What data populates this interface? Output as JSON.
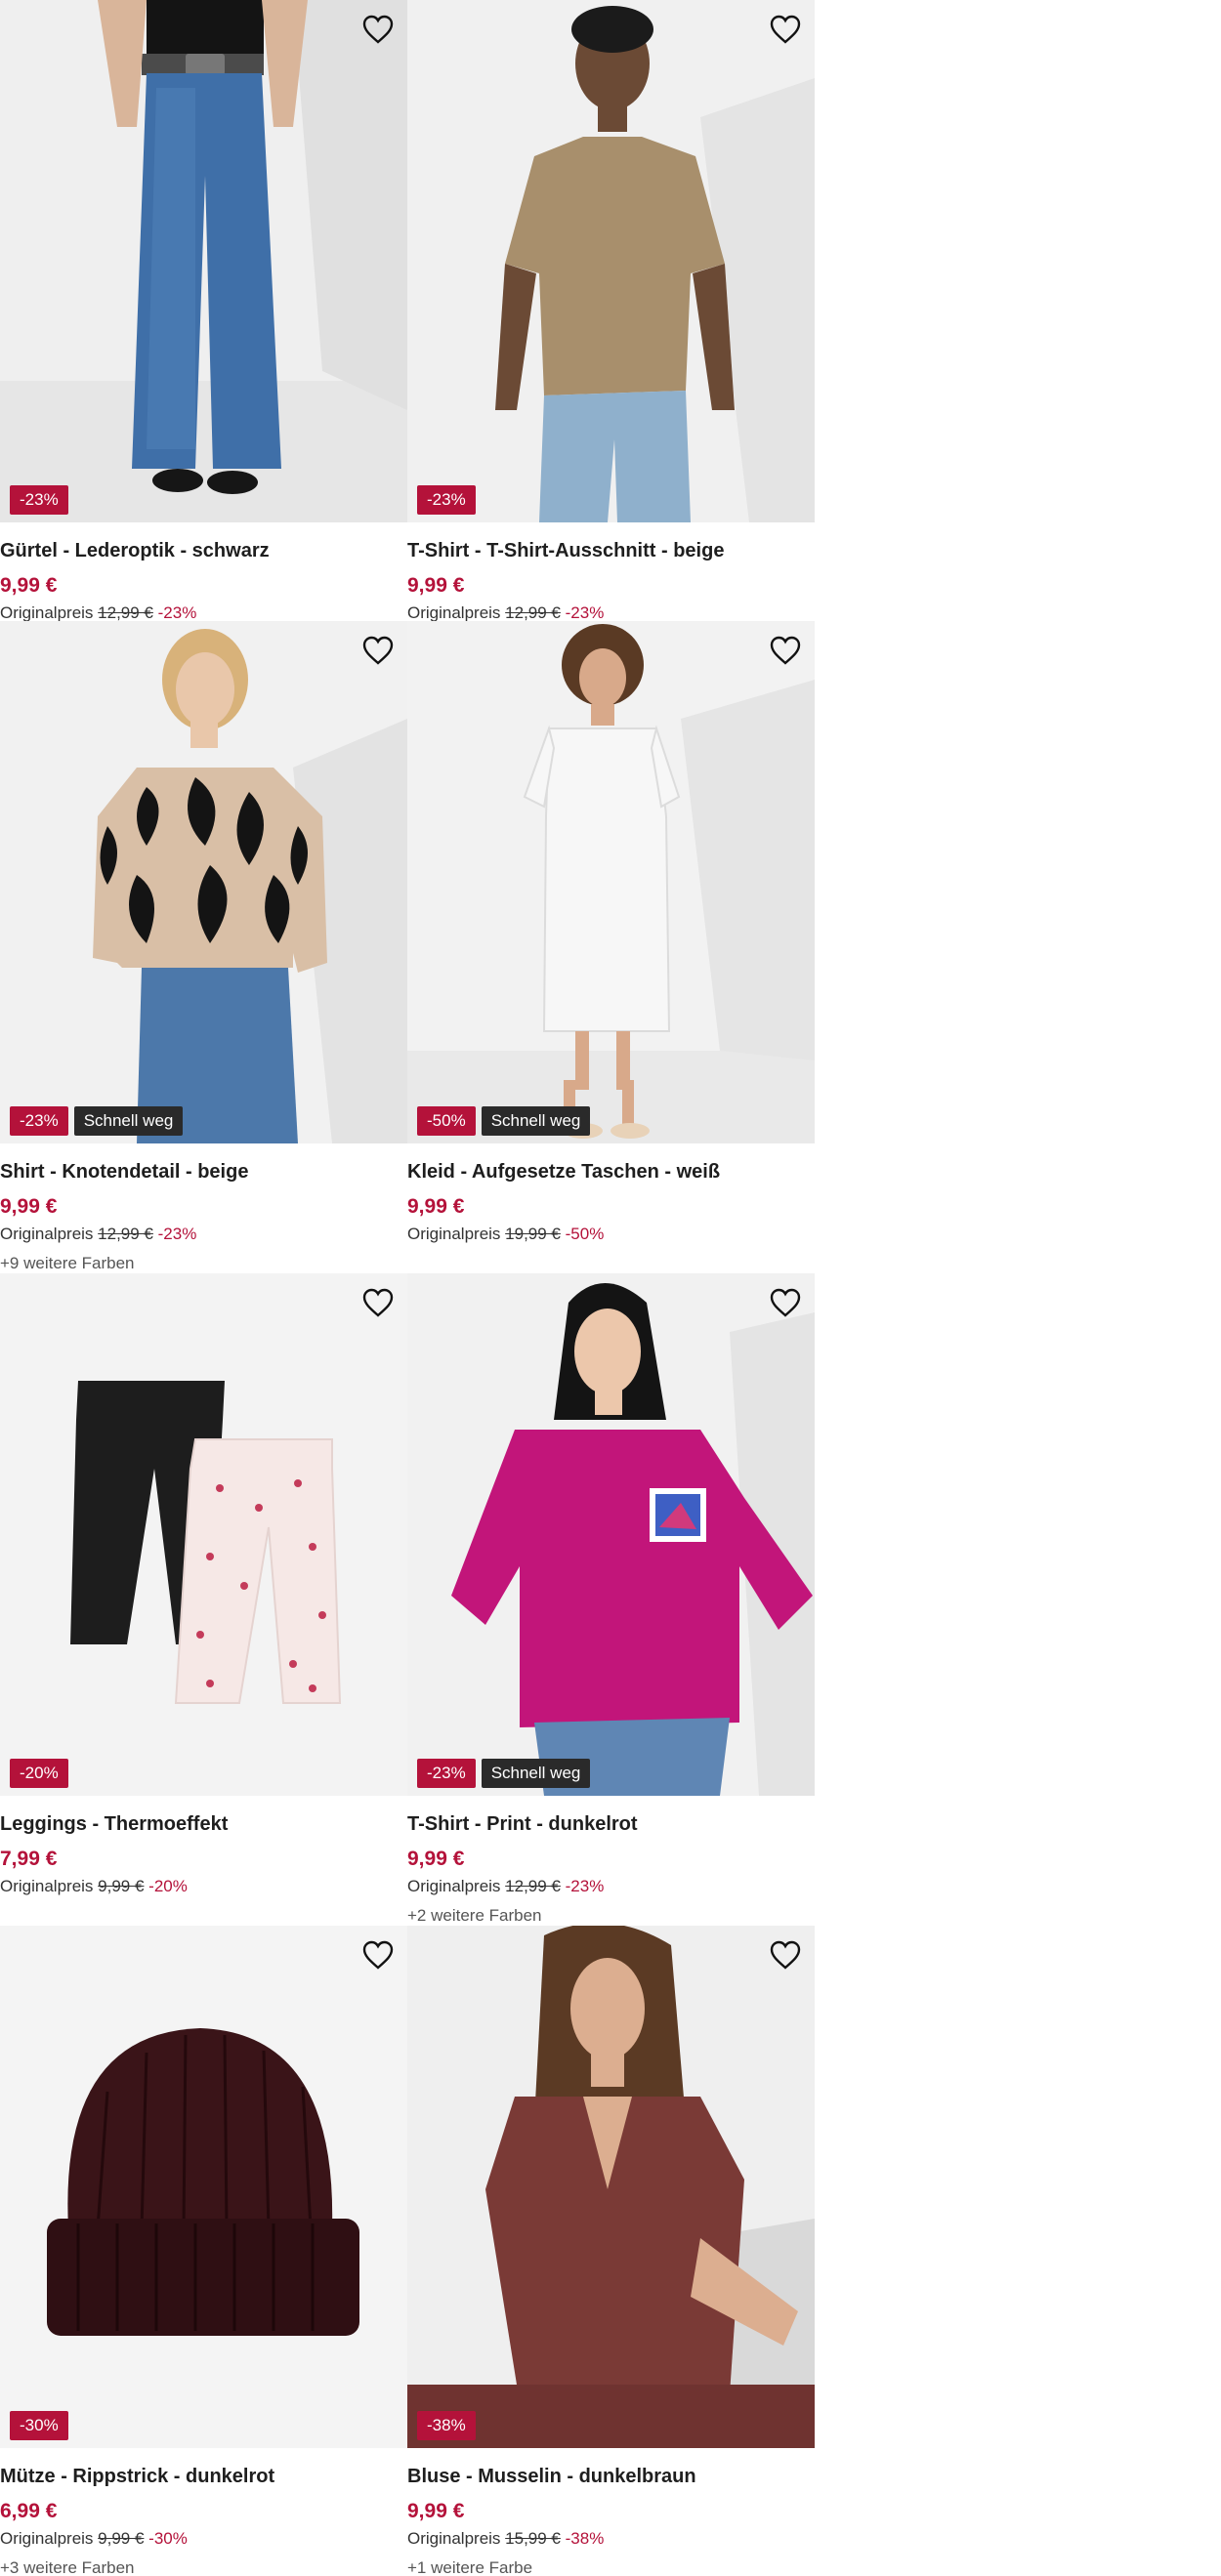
{
  "products": [
    {
      "title": "Gürtel - Lederoptik - schwarz",
      "price": "9,99 €",
      "orig_label": "Originalpreis",
      "orig_price": "12,99 €",
      "discount": "-23%",
      "badge": "-23%",
      "flag": "",
      "more_colors": ""
    },
    {
      "title": "T-Shirt - T-Shirt-Ausschnitt - beige",
      "price": "9,99 €",
      "orig_label": "Originalpreis",
      "orig_price": "12,99 €",
      "discount": "-23%",
      "badge": "-23%",
      "flag": "",
      "more_colors": ""
    },
    {
      "title": "Shirt - Knotendetail - beige",
      "price": "9,99 €",
      "orig_label": "Originalpreis",
      "orig_price": "12,99 €",
      "discount": "-23%",
      "badge": "-23%",
      "flag": "Schnell weg",
      "more_colors": "+9 weitere Farben"
    },
    {
      "title": "Kleid - Aufgesetze Taschen - weiß",
      "price": "9,99 €",
      "orig_label": "Originalpreis",
      "orig_price": "19,99 €",
      "discount": "-50%",
      "badge": "-50%",
      "flag": "Schnell weg",
      "more_colors": ""
    },
    {
      "title": "Leggings - Thermoeffekt",
      "price": "7,99 €",
      "orig_label": "Originalpreis",
      "orig_price": "9,99 €",
      "discount": "-20%",
      "badge": "-20%",
      "flag": "",
      "more_colors": ""
    },
    {
      "title": "T-Shirt - Print - dunkelrot",
      "price": "9,99 €",
      "orig_label": "Originalpreis",
      "orig_price": "12,99 €",
      "discount": "-23%",
      "badge": "-23%",
      "flag": "Schnell weg",
      "more_colors": "+2 weitere Farben"
    },
    {
      "title": "Mütze - Rippstrick - dunkelrot",
      "price": "6,99 €",
      "orig_label": "Originalpreis",
      "orig_price": "9,99 €",
      "discount": "-30%",
      "badge": "-30%",
      "flag": "",
      "more_colors": "+3 weitere Farben"
    },
    {
      "title": "Bluse - Musselin - dunkelbraun",
      "price": "9,99 €",
      "orig_label": "Originalpreis",
      "orig_price": "15,99 €",
      "discount": "-38%",
      "badge": "-38%",
      "flag": "",
      "more_colors": "+1 weitere Farbe"
    }
  ],
  "colors": {
    "accent": "#b4123a",
    "flag_bg": "#2a2a2a",
    "image_bg": "#f2f2f2"
  },
  "icons": {
    "wishlist": "heart-outline-icon"
  }
}
